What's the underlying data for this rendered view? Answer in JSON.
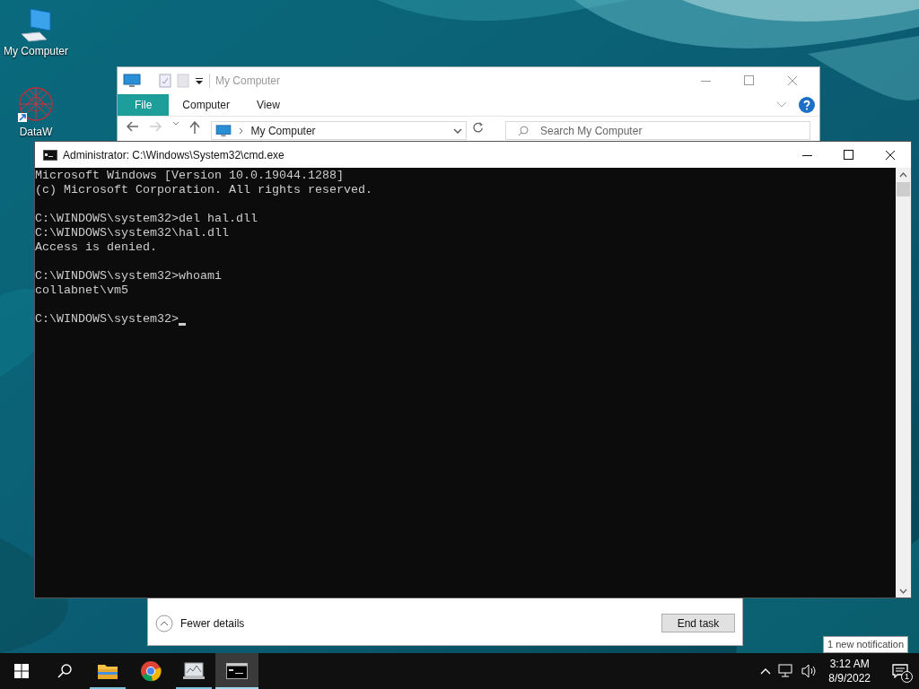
{
  "desktop_icons": [
    {
      "label": "My Computer",
      "kind": "computer"
    },
    {
      "label": "DataW",
      "kind": "app"
    }
  ],
  "explorer": {
    "title": "My Computer",
    "ribbon_tabs": [
      {
        "label": "File",
        "selected": true
      },
      {
        "label": "Computer",
        "selected": false
      },
      {
        "label": "View",
        "selected": false
      }
    ],
    "address": "My Computer",
    "search": {
      "placeholder": "Search My Computer"
    }
  },
  "task_manager": {
    "details_toggle": "Fewer details",
    "end_task": "End task"
  },
  "console": {
    "title": "Administrator: C:\\Windows\\System32\\cmd.exe",
    "blocks": [
      [
        "Microsoft Windows [Version 10.0.19044.1288]",
        "(c) Microsoft Corporation. All rights reserved."
      ],
      [
        "C:\\WINDOWS\\system32>del hal.dll",
        "C:\\WINDOWS\\system32\\hal.dll",
        "Access is denied."
      ],
      [
        "C:\\WINDOWS\\system32>whoami",
        "collabnet\\vm5"
      ],
      [
        "C:\\WINDOWS\\system32>"
      ]
    ]
  },
  "toast": "1 new notification",
  "taskbar": {
    "apps": [
      {
        "kind": "folder",
        "running": true,
        "selected": false
      },
      {
        "kind": "browser",
        "running": false,
        "selected": false
      },
      {
        "kind": "monitor",
        "running": true,
        "selected": false
      },
      {
        "kind": "console",
        "running": true,
        "selected": true
      }
    ],
    "time": "3:12 AM",
    "date": "8/9/2022",
    "notification_count": "1"
  }
}
